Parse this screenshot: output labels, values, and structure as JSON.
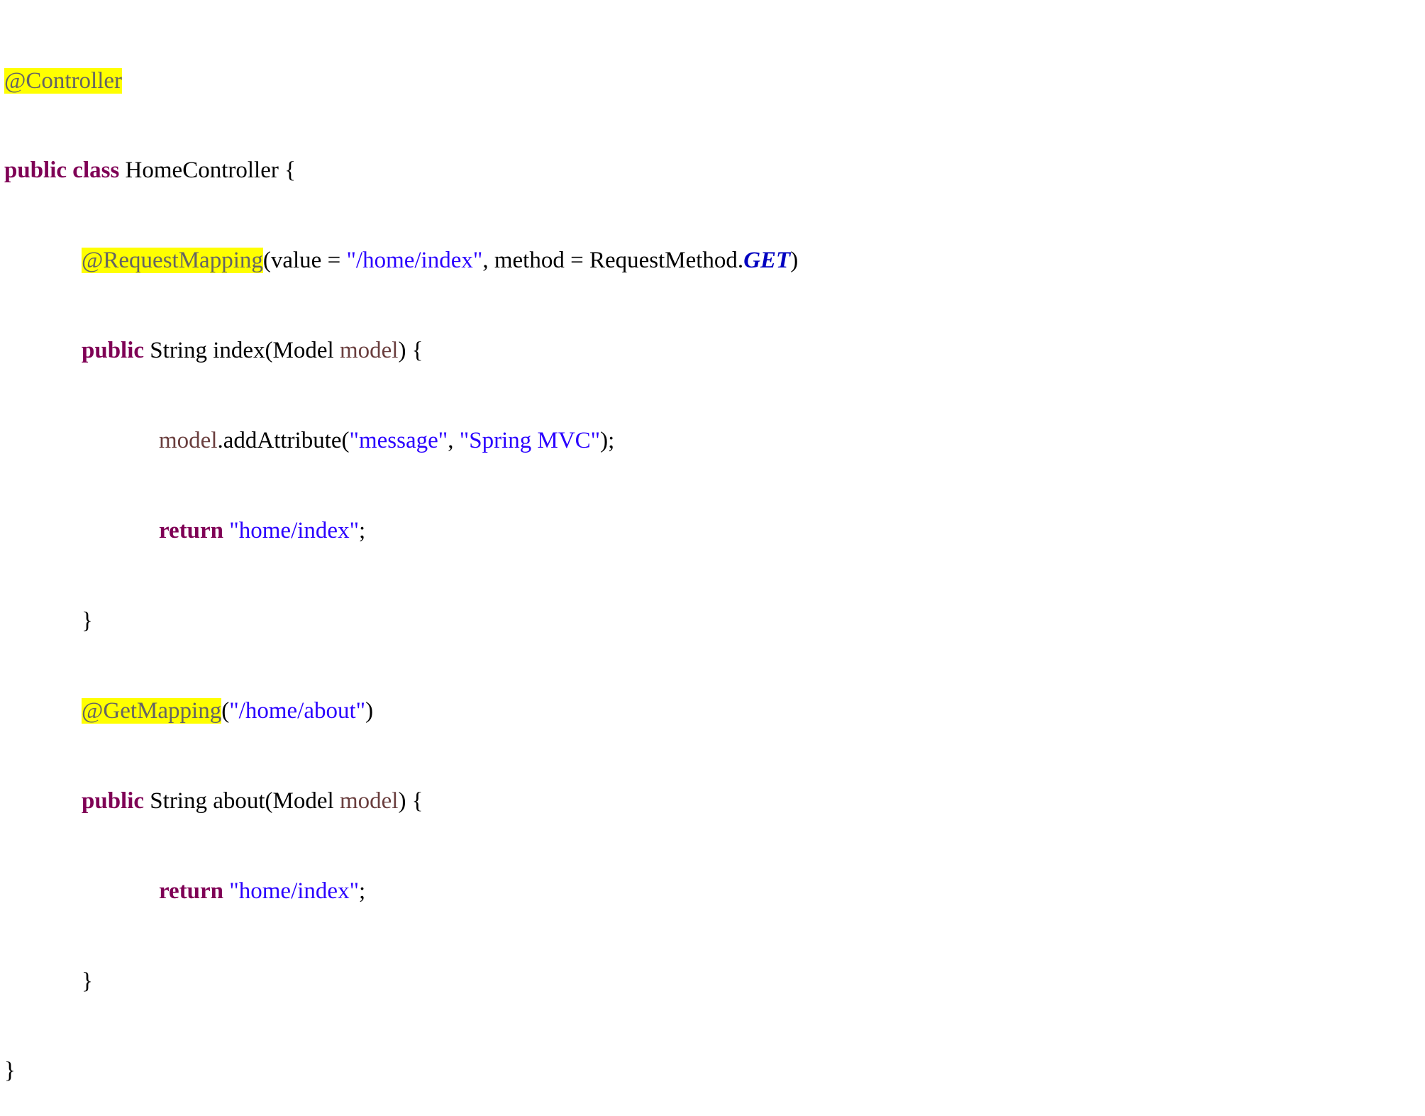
{
  "code": {
    "l1": {
      "annotation": "@Controller"
    },
    "l2": {
      "kw_public": "public",
      "kw_class": "class",
      "name": " HomeController {"
    },
    "l3": {
      "annotation": "@RequestMapping",
      "t1": "(value = ",
      "s1": "\"/home/index\"",
      "t2": ", method = RequestMethod.",
      "enum": "GET",
      "t3": ")"
    },
    "l4": {
      "kw": "public",
      "t1": " String index(Model ",
      "var": "model",
      "t2": ") {"
    },
    "l5": {
      "var": "model",
      "t1": ".addAttribute(",
      "s1": "\"message\"",
      "t2": ", ",
      "s2": "\"Spring MVC\"",
      "t3": ");"
    },
    "l6": {
      "kw": "return",
      "t1": " ",
      "s1": "\"home/index\"",
      "t2": ";"
    },
    "l7": {
      "t": "}"
    },
    "l8": {
      "annotation": "@GetMapping",
      "t1": "(",
      "s1": "\"/home/about\"",
      "t2": ")"
    },
    "l9": {
      "kw": "public",
      "t1": " String about(Model ",
      "var": "model",
      "t2": ") {"
    },
    "l10": {
      "kw": "return",
      "t1": " ",
      "s1": "\"home/index\"",
      "t2": ";"
    },
    "l11": {
      "t": "}"
    },
    "l12": {
      "t": "}"
    }
  }
}
